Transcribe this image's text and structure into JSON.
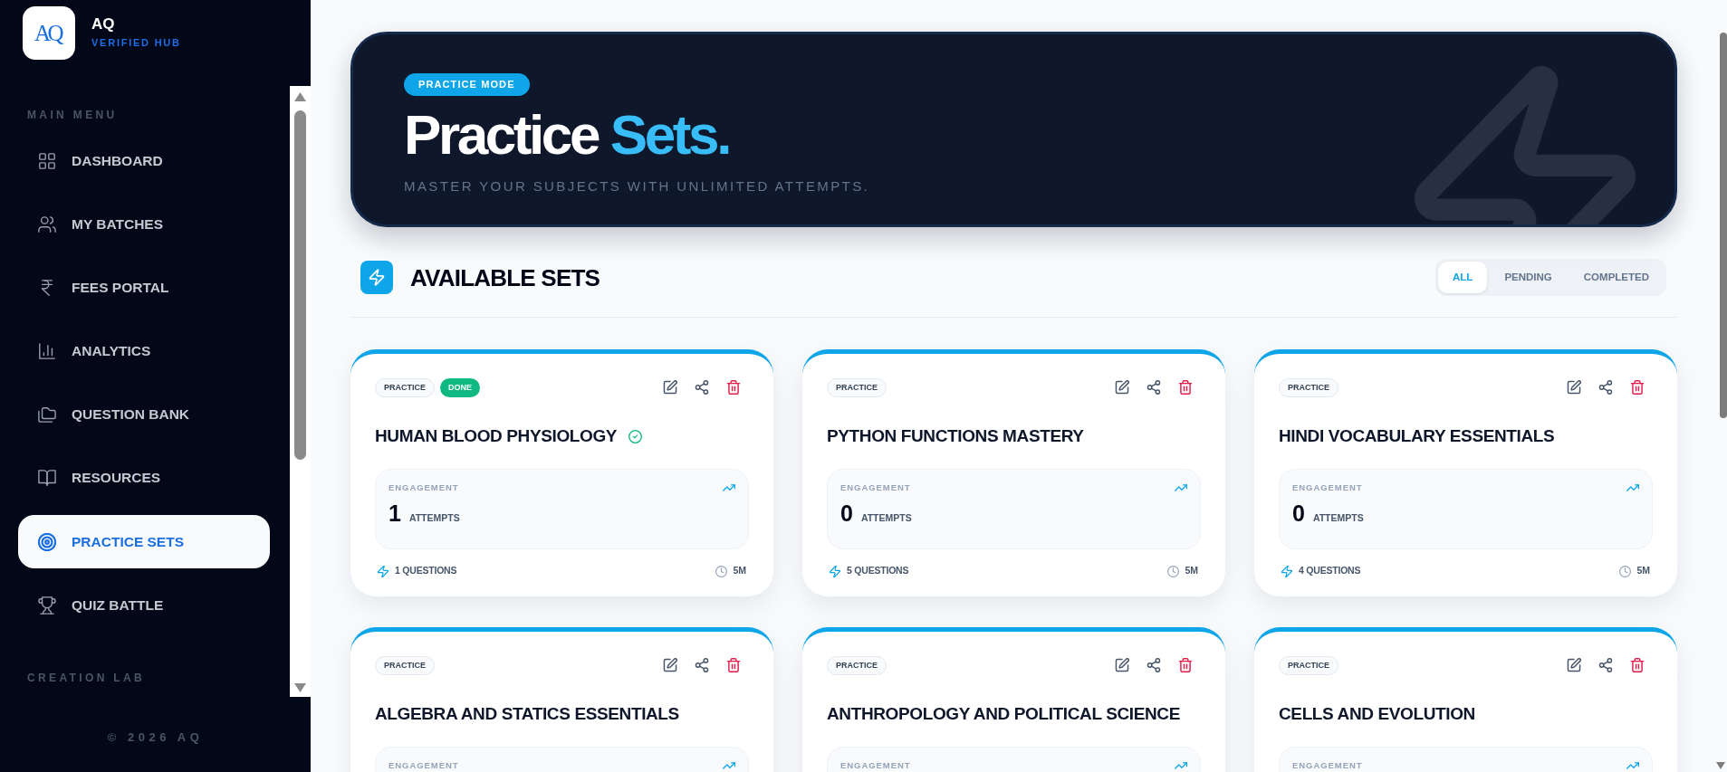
{
  "sidebar": {
    "logo": "AQ",
    "brand": "AQ",
    "tagline": "VERIFIED HUB",
    "sections": [
      {
        "heading": "MAIN MENU",
        "items": [
          {
            "label": "DASHBOARD",
            "selected": false
          },
          {
            "label": "MY BATCHES",
            "selected": false
          },
          {
            "label": "FEES PORTAL",
            "selected": false
          },
          {
            "label": "ANALYTICS",
            "selected": false
          },
          {
            "label": "QUESTION BANK",
            "selected": false
          },
          {
            "label": "RESOURCES",
            "selected": false
          },
          {
            "label": "PRACTICE SETS",
            "selected": true
          },
          {
            "label": "QUIZ BATTLE",
            "selected": false
          }
        ]
      },
      {
        "heading": "CREATION LAB"
      }
    ],
    "footer": "© 2026 AQ"
  },
  "hero": {
    "badge": "PRACTICE MODE",
    "title": "Practice",
    "title_highlight": "Sets.",
    "subtitle": "MASTER YOUR SUBJECTS WITH UNLIMITED ATTEMPTS."
  },
  "sets_header": {
    "title": "AVAILABLE SETS",
    "filters": [
      {
        "label": "ALL",
        "selected": true
      },
      {
        "label": "PENDING",
        "selected": false
      },
      {
        "label": "COMPLETED",
        "selected": false
      }
    ]
  },
  "cards": [
    {
      "tags": [
        {
          "label": "PRACTICE",
          "kind": "type"
        },
        {
          "label": "DONE",
          "kind": "status"
        }
      ],
      "title": "HUMAN BLOOD PHYSIOLOGY",
      "completed": true,
      "engagement_label": "ENGAGEMENT",
      "attempts": "1",
      "attempts_unit": "ATTEMPTS",
      "questions": "1 QUESTIONS",
      "duration": "5M"
    },
    {
      "tags": [
        {
          "label": "PRACTICE",
          "kind": "type"
        }
      ],
      "title": "PYTHON FUNCTIONS MASTERY",
      "completed": false,
      "engagement_label": "ENGAGEMENT",
      "attempts": "0",
      "attempts_unit": "ATTEMPTS",
      "questions": "5 QUESTIONS",
      "duration": "5M"
    },
    {
      "tags": [
        {
          "label": "PRACTICE",
          "kind": "type"
        }
      ],
      "title": "HINDI VOCABULARY ESSENTIALS",
      "completed": false,
      "engagement_label": "ENGAGEMENT",
      "attempts": "0",
      "attempts_unit": "ATTEMPTS",
      "questions": "4 QUESTIONS",
      "duration": "5M"
    },
    {
      "tags": [
        {
          "label": "PRACTICE",
          "kind": "type"
        }
      ],
      "title": "ALGEBRA AND STATICS ESSENTIALS",
      "completed": false,
      "engagement_label": "ENGAGEMENT"
    },
    {
      "tags": [
        {
          "label": "PRACTICE",
          "kind": "type"
        }
      ],
      "title": "ANTHROPOLOGY AND POLITICAL SCIENCE",
      "completed": false,
      "engagement_label": "ENGAGEMENT"
    },
    {
      "tags": [
        {
          "label": "PRACTICE",
          "kind": "type"
        }
      ],
      "title": "CELLS AND EVOLUTION",
      "completed": false,
      "engagement_label": "ENGAGEMENT"
    }
  ]
}
